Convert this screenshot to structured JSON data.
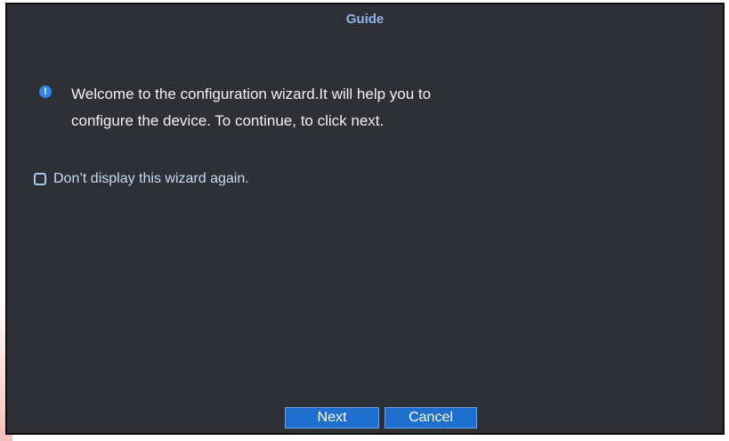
{
  "dialog": {
    "title": "Guide",
    "message_line1": "Welcome to the configuration wizard.It will help you to",
    "message_line2": "configure the device. To continue, to click next.",
    "info_icon_glyph": "!",
    "checkbox_label": "Don’t display this wizard again.",
    "checkbox_checked": false
  },
  "buttons": {
    "next_label": "Next",
    "cancel_label": "Cancel"
  },
  "colors": {
    "dialog_background": "#2f3036",
    "title": "#8fb4ec",
    "button": "#1f6fd0",
    "info_icon": "#2f86e6"
  },
  "icons": {
    "info": "info-icon",
    "checkbox": "checkbox-icon"
  }
}
